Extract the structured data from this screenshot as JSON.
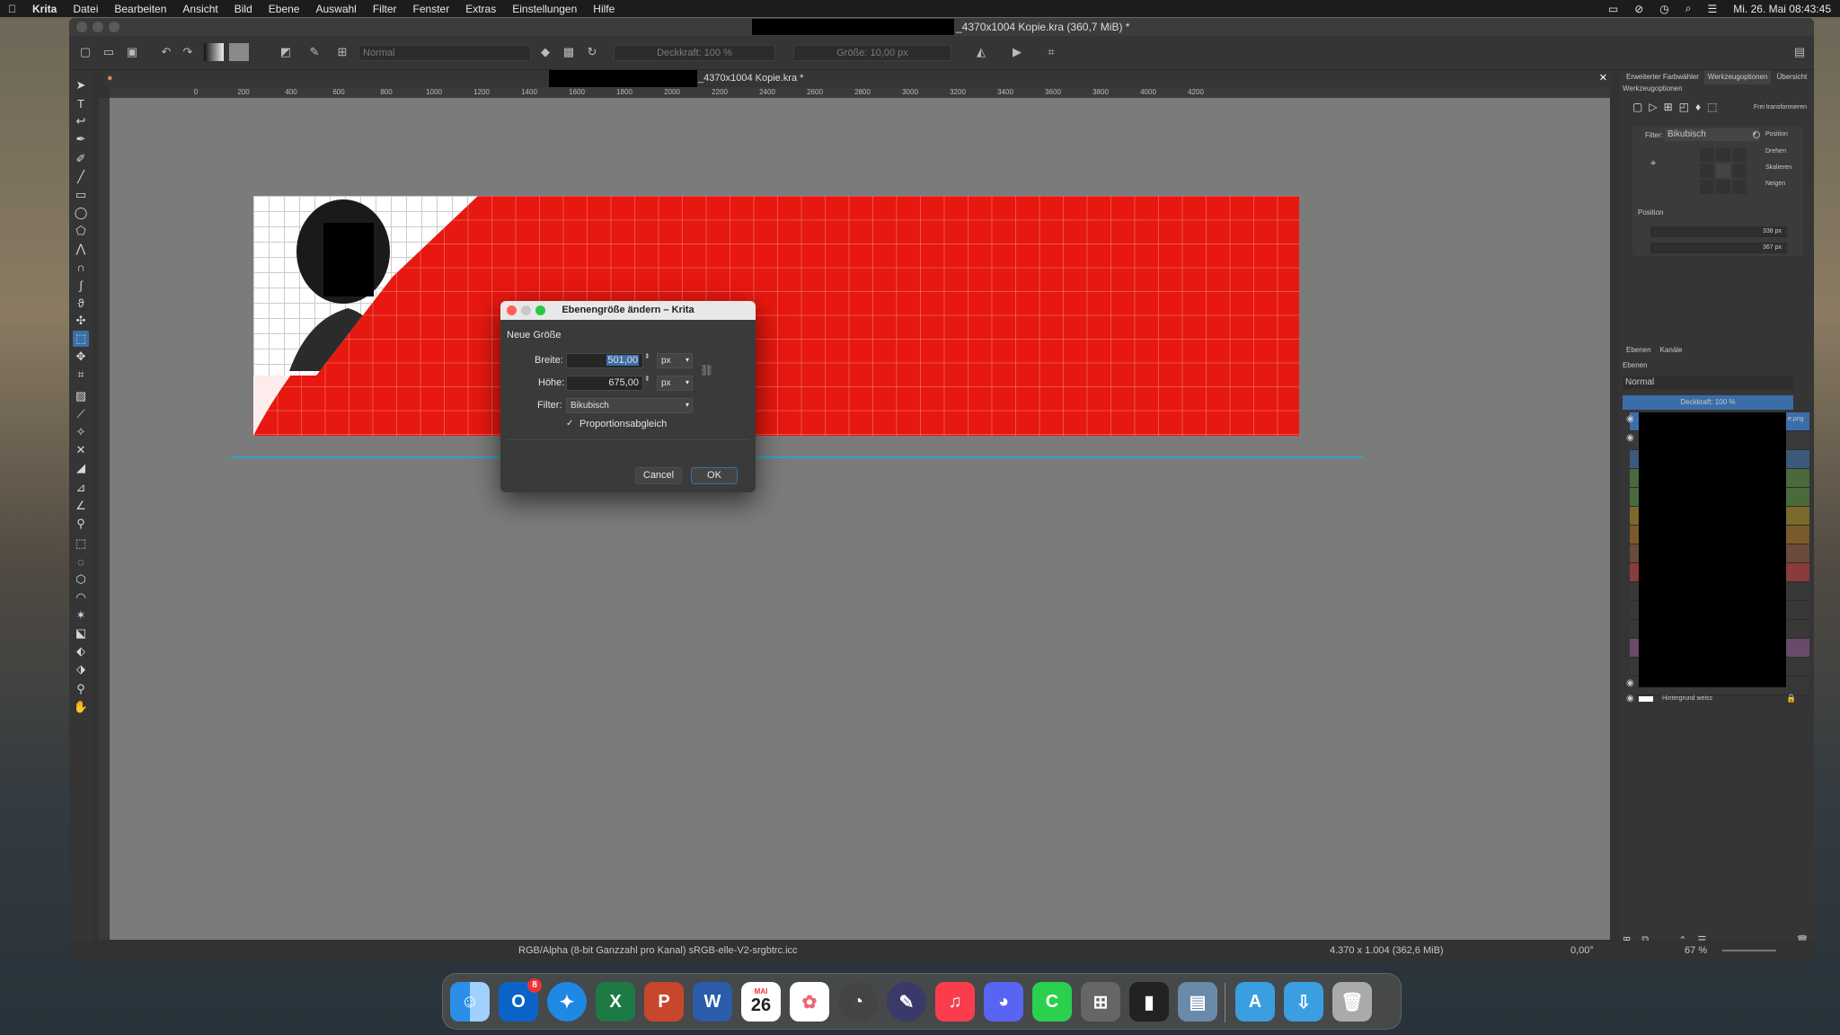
{
  "menubar": {
    "app": "Krita",
    "items": [
      "Datei",
      "Bearbeiten",
      "Ansicht",
      "Bild",
      "Ebene",
      "Auswahl",
      "Filter",
      "Fenster",
      "Extras",
      "Einstellungen",
      "Hilfe"
    ],
    "datetime": "Mi. 26. Mai 08:43:45"
  },
  "window": {
    "title": "_4370x1004 Kopie.kra (360,7 MiB) *",
    "doc_tab": "_4370x1004 Kopie.kra *"
  },
  "toolbar": {
    "blend_mode": "Normal",
    "opacity": "Deckkraft: 100 %",
    "size": "Größe: 10,00 px"
  },
  "ruler": [
    "0",
    "200",
    "400",
    "600",
    "800",
    "1000",
    "1200",
    "1400",
    "1600",
    "1800",
    "2000",
    "2200",
    "2400",
    "2600",
    "2800",
    "3000",
    "3200",
    "3400",
    "3600",
    "3800",
    "4000",
    "4200"
  ],
  "dialog": {
    "title": "Ebenengröße ändern – Krita",
    "section": "Neue Größe",
    "width_label": "Breite:",
    "width_value": "501,00",
    "width_unit": "px",
    "height_label": "Höhe:",
    "height_value": "675,00",
    "height_unit": "px",
    "filter_label": "Filter:",
    "filter_value": "Bikubisch",
    "proportion_label": "Proportionsabgleich",
    "proportion_checked": "✓",
    "cancel": "Cancel",
    "ok": "OK"
  },
  "status": {
    "color_info": "RGB/Alpha (8-bit Ganzzahl pro Kanal)  sRGB-elle-V2-srgbtrc.icc",
    "dimensions": "4.370 x 1.004 (362,6 MiB)",
    "rotation": "0,00°",
    "zoom": "67 %"
  },
  "right_panel": {
    "tabs": [
      "Erweiterter Farbwähler",
      "Werkzeugoptionen",
      "Übersicht"
    ],
    "section_title": "Werkzeugoptionen",
    "transform_label": "Frei transformieren",
    "filter_label": "Filter:",
    "filter_value": "Bikubisch",
    "options": [
      "Position",
      "Drehen",
      "Skalieren",
      "Neigen"
    ],
    "position_label": "Position",
    "pos_x": "338 px",
    "pos_y": "367 px",
    "layer_tabs": [
      "Ebenen",
      "Kanäle"
    ],
    "layers_title": "Ebenen",
    "layer_blend": "Normal",
    "layer_opacity": "Deckkraft:  100 %",
    "top_layer_name": "e.png",
    "bottom_layer": "Hintergrund weiss"
  },
  "colors": {
    "banner_red": "#e6180f",
    "guide": "#36a2c8",
    "selection": "#3b6ea8"
  },
  "dock_badge": "8",
  "calendar": {
    "month": "MAI",
    "day": "26"
  }
}
